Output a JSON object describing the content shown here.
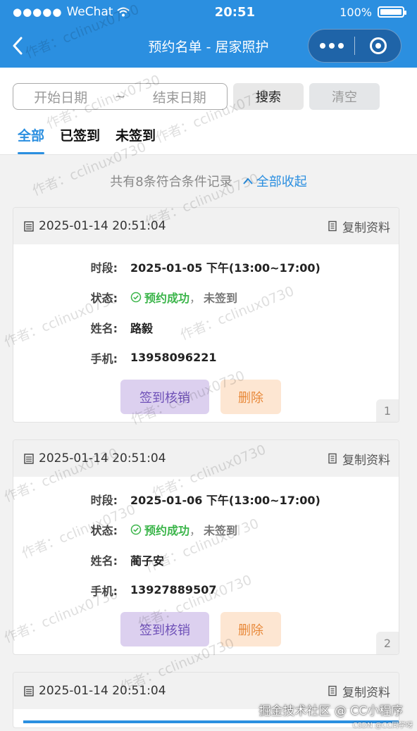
{
  "statusbar": {
    "signal": "●●●●●",
    "carrier": "WeChat",
    "time": "20:51",
    "battery": "100%"
  },
  "navbar": {
    "title": "预约名单 - 居家照护"
  },
  "toolbar": {
    "start_placeholder": "开始日期",
    "separator": "~",
    "end_placeholder": "结束日期",
    "search_label": "搜索",
    "clear_label": "清空"
  },
  "tabs": [
    {
      "label": "全部",
      "active": true
    },
    {
      "label": "已签到",
      "active": false
    },
    {
      "label": "未签到",
      "active": false
    }
  ],
  "summary": {
    "text": "共有8条符合条件记录",
    "collapse_label": "全部收起"
  },
  "labels": {
    "slot": "时段:",
    "status": "状态:",
    "name": "姓名:",
    "phone": "手机:",
    "copy": "复制资料",
    "checkin": "签到核销",
    "delete": "删除",
    "status_ok": "预约成功",
    "status_sep": "，",
    "status_unsigned": "未签到"
  },
  "records": [
    {
      "timestamp": "2025-01-14 20:51:04",
      "slot": "2025-01-05 下午(13:00~17:00)",
      "name": "路毅",
      "phone": "13958096221",
      "index": "1"
    },
    {
      "timestamp": "2025-01-14 20:51:04",
      "slot": "2025-01-06 下午(13:00~17:00)",
      "name": "蔺子安",
      "phone": "13927889507",
      "index": "2"
    },
    {
      "timestamp": "2025-01-14 20:51:04"
    }
  ],
  "watermark": {
    "text": "作者：cclinux0730"
  },
  "footer": {
    "text": "掘金技术社区 @ CC小程序",
    "csdn": "CSDN @CC同学呀"
  },
  "colors": {
    "primary": "#2b8fe0",
    "success": "#3bb54a",
    "purple_btn": "#dcd0ef",
    "orange_btn": "#fde6d2"
  }
}
